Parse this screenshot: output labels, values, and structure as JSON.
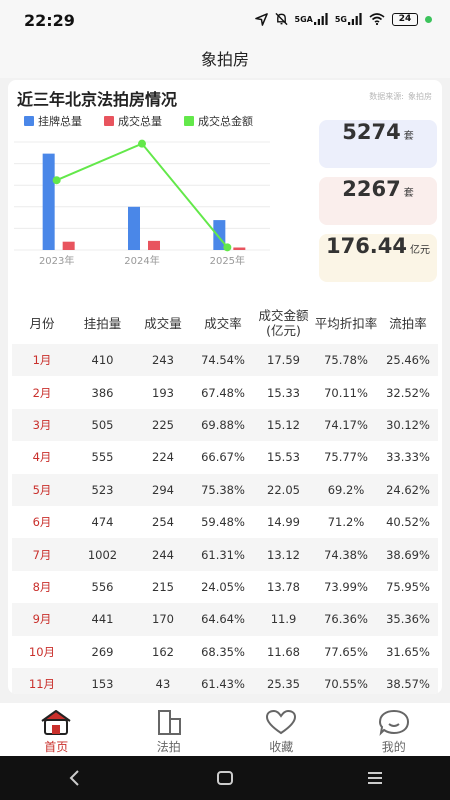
{
  "status": {
    "time": "22:29",
    "sig1": "5GA",
    "sig2": "5G",
    "battery": "24"
  },
  "app": {
    "title": "象拍房"
  },
  "section": {
    "title": "近三年北京法拍房情况",
    "source_label": "数据来源:",
    "source_name": "象拍房"
  },
  "chart_data": {
    "type": "bar",
    "categories": [
      "2023年",
      "2024年",
      "2025年"
    ],
    "series": [
      {
        "name": "挂牌总量",
        "values": [
          5800,
          2600,
          1800
        ],
        "kind": "bar",
        "color": "#4a87e8"
      },
      {
        "name": "成交总量",
        "values": [
          500,
          550,
          150
        ],
        "kind": "bar",
        "color": "#e8545e"
      },
      {
        "name": "成交总金额",
        "values": [
          4200,
          6400,
          160
        ],
        "kind": "line",
        "color": "#63e84a"
      }
    ],
    "ylim": [
      0,
      6500
    ]
  },
  "stats": [
    {
      "value": "5274",
      "unit": "套",
      "color": "#eceffb"
    },
    {
      "value": "2267",
      "unit": "套",
      "color": "#faeeec"
    },
    {
      "value": "176.44",
      "unit": "亿元",
      "color": "#fbf5e6"
    }
  ],
  "table": {
    "headers": [
      "月份",
      "挂拍量",
      "成交量",
      "成交率",
      "成交金额(亿元)",
      "平均折扣率",
      "流拍率"
    ],
    "rows": [
      [
        "1月",
        "410",
        "243",
        "74.54%",
        "17.59",
        "75.78%",
        "25.46%"
      ],
      [
        "2月",
        "386",
        "193",
        "67.48%",
        "15.33",
        "70.11%",
        "32.52%"
      ],
      [
        "3月",
        "505",
        "225",
        "69.88%",
        "15.12",
        "74.17%",
        "30.12%"
      ],
      [
        "4月",
        "555",
        "224",
        "66.67%",
        "15.53",
        "75.77%",
        "33.33%"
      ],
      [
        "5月",
        "523",
        "294",
        "75.38%",
        "22.05",
        "69.2%",
        "24.62%"
      ],
      [
        "6月",
        "474",
        "254",
        "59.48%",
        "14.99",
        "71.2%",
        "40.52%"
      ],
      [
        "7月",
        "1002",
        "244",
        "61.31%",
        "13.12",
        "74.38%",
        "38.69%"
      ],
      [
        "8月",
        "556",
        "215",
        "24.05%",
        "13.78",
        "73.99%",
        "75.95%"
      ],
      [
        "9月",
        "441",
        "170",
        "64.64%",
        "11.9",
        "76.36%",
        "35.36%"
      ],
      [
        "10月",
        "269",
        "162",
        "68.35%",
        "11.68",
        "77.65%",
        "31.65%"
      ],
      [
        "11月",
        "153",
        "43",
        "61.43%",
        "25.35",
        "70.55%",
        "38.57%"
      ]
    ]
  },
  "tabs": [
    {
      "label": "首页",
      "icon": "home-icon",
      "active": true
    },
    {
      "label": "法拍",
      "icon": "building-icon",
      "active": false
    },
    {
      "label": "收藏",
      "icon": "heart-icon",
      "active": false
    },
    {
      "label": "我的",
      "icon": "profile-icon",
      "active": false
    }
  ],
  "colors": {
    "accent": "#c9302c"
  }
}
